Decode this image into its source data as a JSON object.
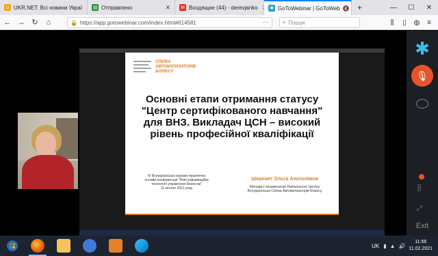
{
  "browser": {
    "tabs": [
      {
        "title": "UKR.NET: Всі новини Украї",
        "favicon_color": "#f2a40e",
        "favicon_glyph": "U",
        "active": false
      },
      {
        "title": "Отправлено",
        "favicon_color": "#2b8a3e",
        "favicon_glyph": "▤",
        "active": false
      },
      {
        "title": "Входящие (44) - derevjanko",
        "favicon_color": "#d93025",
        "favicon_glyph": "M",
        "active": false
      },
      {
        "title": "GoToWebinar | GoToWeb",
        "favicon_color": "#1fa2d8",
        "favicon_glyph": "✱",
        "active": true
      }
    ],
    "url": "https://app.gotowebinar.com/index.html#614581",
    "search_placeholder": "Пошук"
  },
  "slide": {
    "logo_text": [
      "СПІЛКА",
      "АВТОМАТИЗАТОРІВ",
      "БІЗНЕСУ"
    ],
    "title_lines": [
      "Основні етапи отримання статусу",
      "\"Центр сертифікованого навчання\"",
      "для ВНЗ. Викладач ЦСН – високий",
      "рівень професійної кваліфікації"
    ],
    "left_note": [
      "IV Всеукраїнська науково-практична",
      "онлайн-конференція \"Нові інформаційні",
      "технології управління бізнесом\"",
      "11 лютого 2021 року"
    ],
    "author": "Шеремет Ольга Анатоліївна",
    "author_role": [
      "Методист-екзаменатор Навчального Центру",
      "Всеукраїнська Спілка Автоматизаторів Бізнесу"
    ],
    "accent": "#e07b1f"
  },
  "sidepanel": {
    "exit_label": "Exit",
    "mic_color": "#e8542a"
  },
  "taskbar": {
    "language": "UK",
    "time": "11:56",
    "date": "11.02.2021"
  }
}
